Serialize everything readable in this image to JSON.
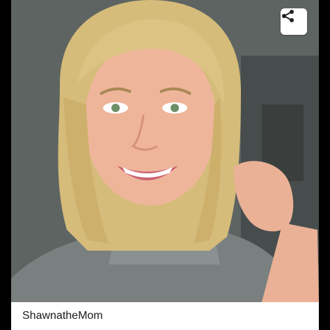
{
  "post": {
    "author": "ShawnatheMom",
    "image": {
      "subject": "portrait-photo"
    }
  },
  "actions": {
    "share_icon": "share-icon"
  },
  "colors": {
    "page_background": "#000000",
    "card_background": "#ffffff",
    "caption_text": "#1b1b1b",
    "share_icon": "#222222"
  }
}
